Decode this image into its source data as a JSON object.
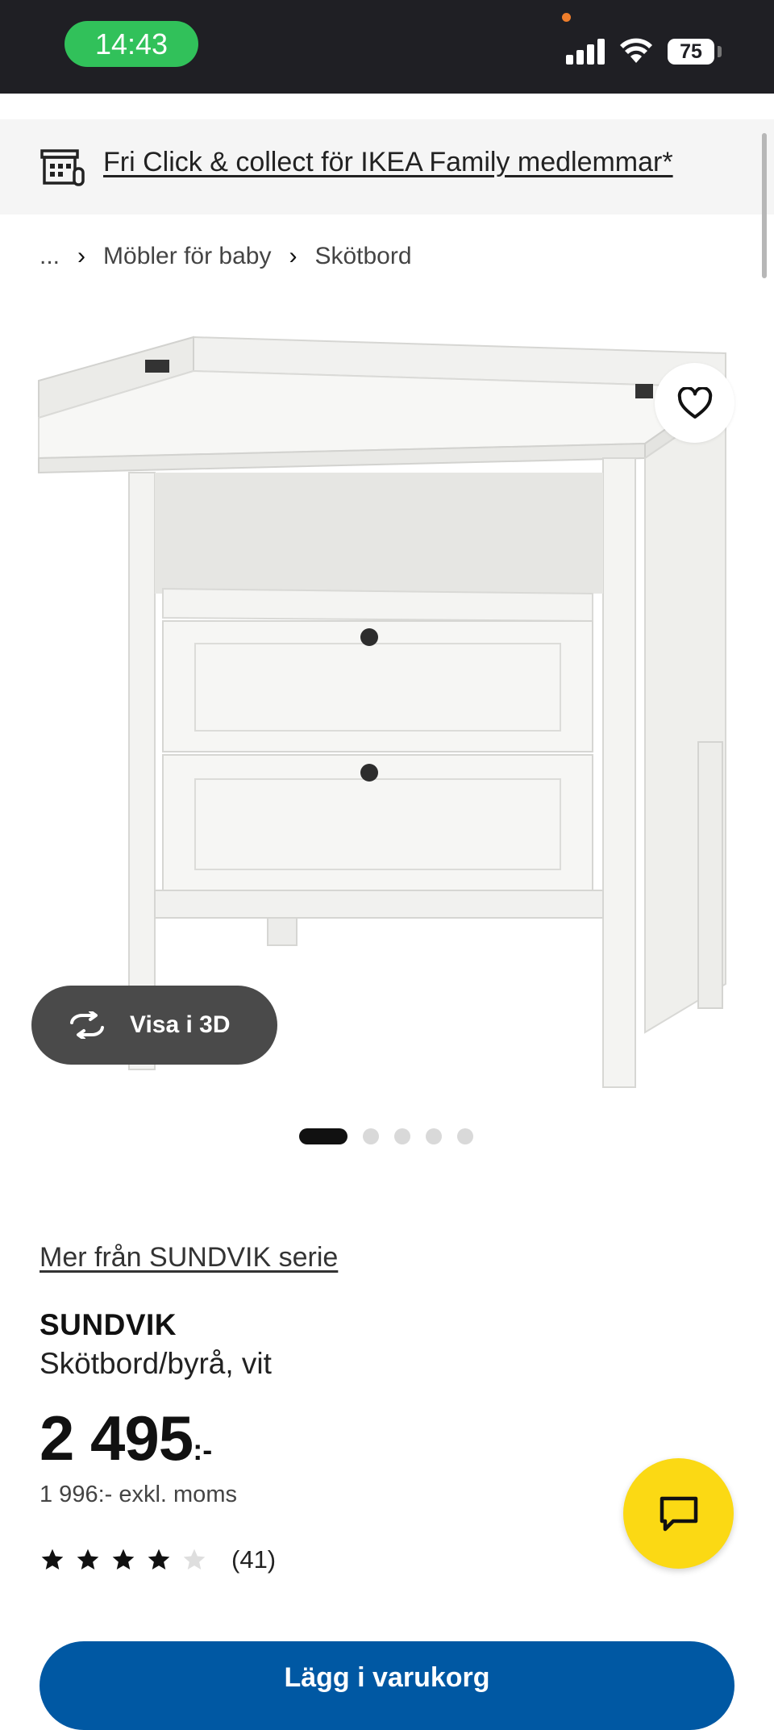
{
  "status_bar": {
    "time": "14:43",
    "battery_level": "75",
    "icons": [
      "signal-icon",
      "wifi-icon",
      "battery-icon"
    ]
  },
  "banner": {
    "icon": "store-icon",
    "text": "Fri Click & collect för IKEA Family medlemmar*"
  },
  "breadcrumb": {
    "ellipsis": "...",
    "items": [
      "Möbler för baby",
      "Skötbord"
    ]
  },
  "gallery": {
    "view_3d_label": "Visa i 3D",
    "image_count": 5,
    "active_index": 0
  },
  "product": {
    "series_link": "Mer från SUNDVIK serie",
    "name": "SUNDVIK",
    "description": "Skötbord/byrå, vit",
    "price_main": "2 495",
    "price_suffix": ":-",
    "price_ex_vat": "1 996:- exkl. moms",
    "rating_value": 4,
    "rating_max": 5,
    "review_count": "(41)"
  },
  "cta": {
    "label": "Lägg i varukorg"
  },
  "colors": {
    "status_bar": "#1f1f24",
    "time_pill": "#31c15a",
    "chat_button": "#fbd914",
    "cta_blue": "#0058a3",
    "view3d_pill": "#4a4a4a"
  }
}
